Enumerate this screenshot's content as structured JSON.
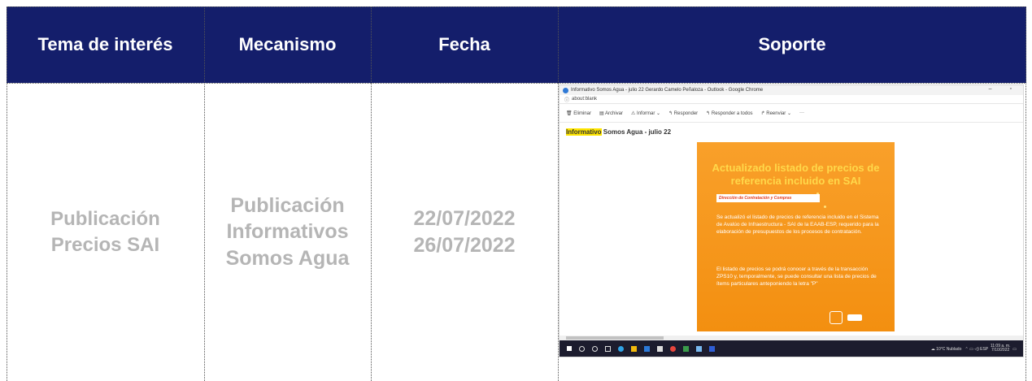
{
  "table": {
    "headers": [
      "Tema de interés",
      "Mecanismo",
      "Fecha",
      "Soporte"
    ],
    "row": {
      "tema": [
        "Publicación",
        "Precios SAI"
      ],
      "mecanismo": [
        "Publicación",
        "Informativos",
        "Somos Agua"
      ],
      "fecha": [
        "22/07/2022",
        "26/07/2022"
      ]
    }
  },
  "support_image": {
    "window_title": "Informativo Somos Agua - julio 22 Gerardo Camelo Peñaloza - Outlook - Google Chrome",
    "url": "about:blank",
    "toolbar": [
      "Eliminar",
      "Archivar",
      "Informar",
      "Responder",
      "Responder a todos",
      "Reenviar",
      "···"
    ],
    "subject_highlight": "Informativo",
    "subject_rest": " Somos Agua - julio 22",
    "poster": {
      "title": "Actualizado listado de precios de referencia incluido en SAI",
      "tag": "Dirección de Contratación y Compras",
      "paragraph1": "Se actualizó el listado de precios de referencia incluido en el Sistema de Avalúo de Infraestructura - SAI de la EAAB-ESP, requerido para la elaboración de presupuestos de los procesos de contratación.",
      "paragraph2": "El listado de precios se podrá conocer a través de la transacción ZPS10 y, temporalmente, se puede consultar una lista de precios de ítems particulares anteponiendo la letra \"P\""
    },
    "taskbar": {
      "weather": "10°C Nublado",
      "lang": "ESP",
      "time": "11:09 a. m.",
      "date": "7/10/2022"
    }
  },
  "colors": {
    "header_bg": "#141e6b",
    "header_text": "#ffffff",
    "body_text": "#b5b5b5",
    "poster_bg": "#f7941d",
    "poster_title": "#ffd84a"
  }
}
